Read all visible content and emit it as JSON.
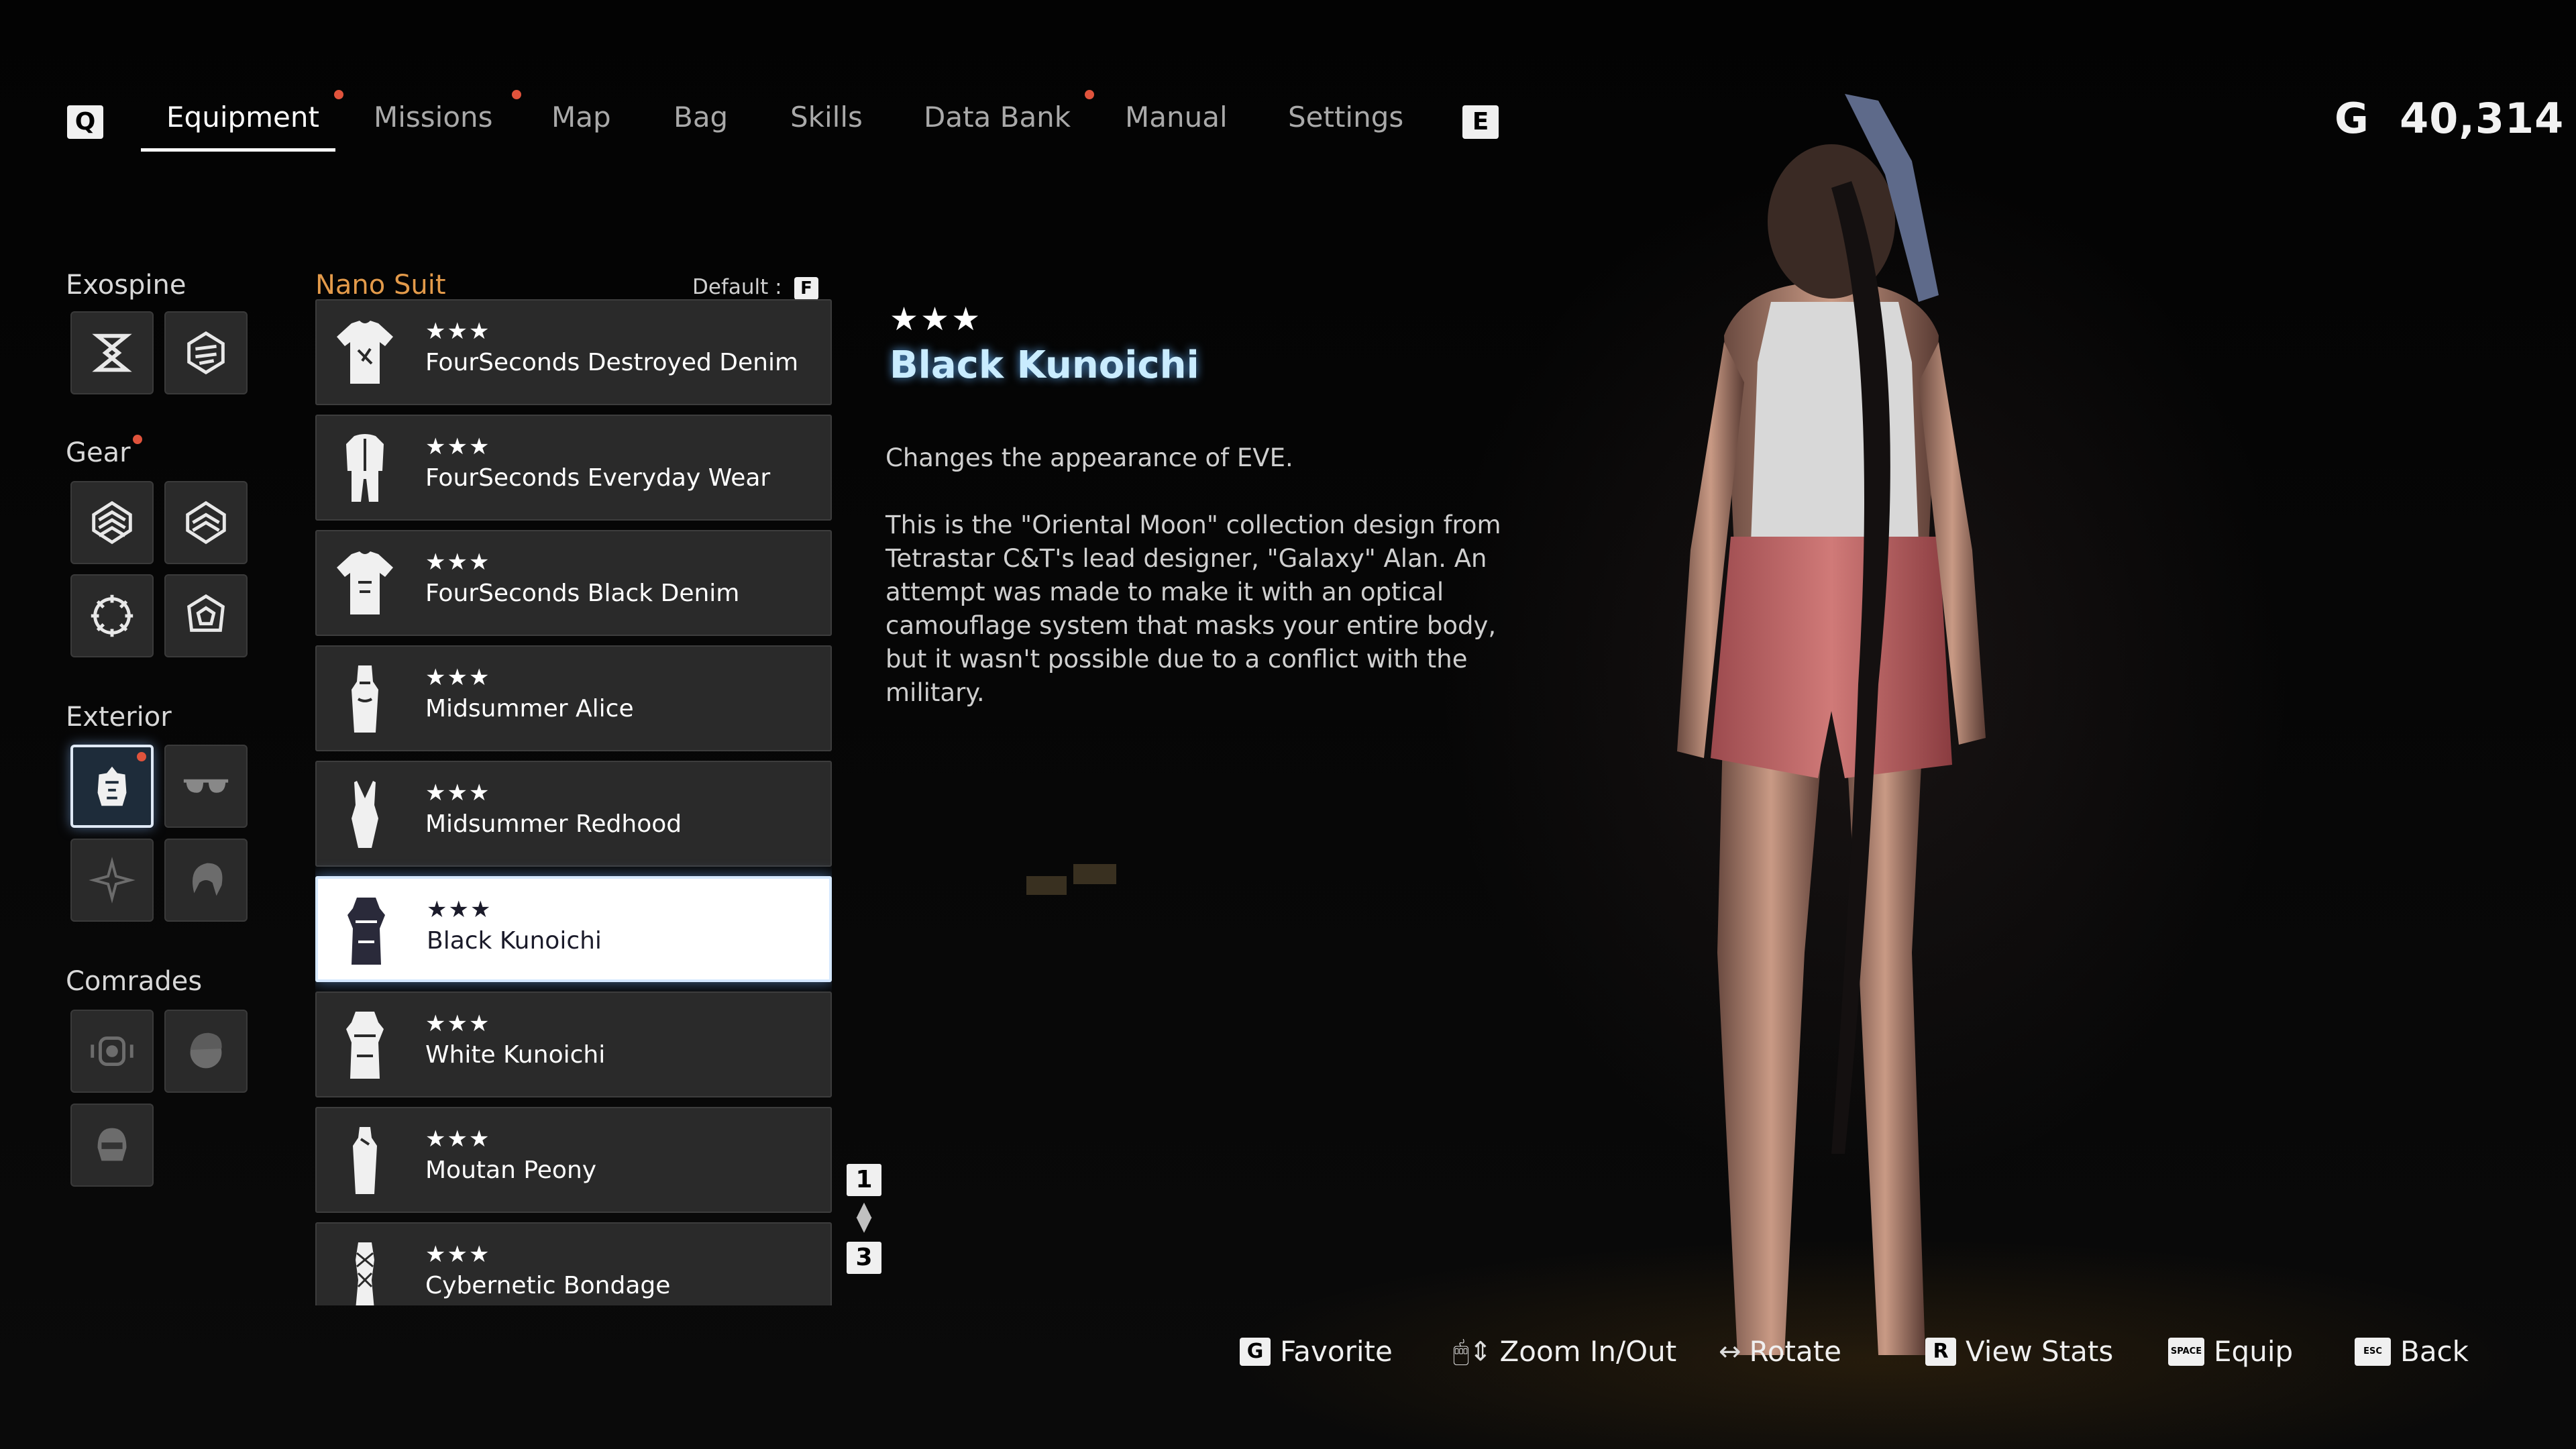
{
  "nav": {
    "left_key": "Q",
    "right_key": "E",
    "tabs": [
      {
        "label": "Equipment",
        "active": true,
        "notify": true
      },
      {
        "label": "Missions",
        "active": false,
        "notify": true
      },
      {
        "label": "Map",
        "active": false,
        "notify": false
      },
      {
        "label": "Bag",
        "active": false,
        "notify": false
      },
      {
        "label": "Skills",
        "active": false,
        "notify": false
      },
      {
        "label": "Data Bank",
        "active": false,
        "notify": true
      },
      {
        "label": "Manual",
        "active": false,
        "notify": false
      },
      {
        "label": "Settings",
        "active": false,
        "notify": false
      }
    ]
  },
  "currency": {
    "symbol": "G",
    "amount": "40,314"
  },
  "categories": {
    "exospine": "Exospine",
    "gear": "Gear",
    "exterior": "Exterior",
    "comrades": "Comrades"
  },
  "list": {
    "title": "Nano Suit",
    "default_label": "Default :",
    "default_key": "F",
    "items": [
      {
        "stars": "★★★",
        "name": "FourSeconds Destroyed Denim",
        "icon": "tshirt-icon"
      },
      {
        "stars": "★★★",
        "name": "FourSeconds Everyday Wear",
        "icon": "hoodie-outfit-icon"
      },
      {
        "stars": "★★★",
        "name": "FourSeconds Black Denim",
        "icon": "tshirt-icon"
      },
      {
        "stars": "★★★",
        "name": "Midsummer Alice",
        "icon": "dress-icon"
      },
      {
        "stars": "★★★",
        "name": "Midsummer Redhood",
        "icon": "swimsuit-icon"
      },
      {
        "stars": "★★★",
        "name": "Black Kunoichi",
        "icon": "kunoichi-outfit-icon",
        "selected": true
      },
      {
        "stars": "★★★",
        "name": "White Kunoichi",
        "icon": "kunoichi-outfit-icon"
      },
      {
        "stars": "★★★",
        "name": "Moutan Peony",
        "icon": "qipao-icon"
      },
      {
        "stars": "★★★",
        "name": "Cybernetic Bondage",
        "icon": "bodysuit-icon"
      }
    ],
    "page_current": "1",
    "page_total": "3"
  },
  "detail": {
    "stars": "★★★",
    "title": "Black Kunoichi",
    "description_1": "Changes the appearance of EVE.",
    "description_2": "This is the \"Oriental Moon\" collection design from Tetrastar C&T's lead designer, \"Galaxy\" Alan. An attempt was made to make it with an optical camouflage system that masks your entire body, but it wasn't possible due to a conflict with the military."
  },
  "prompts": [
    {
      "key": "G",
      "label": "Favorite"
    },
    {
      "key": "",
      "label": "Zoom In/Out"
    },
    {
      "key": "",
      "label": "Rotate"
    },
    {
      "key": "R",
      "label": "View Stats"
    },
    {
      "key": "SPACE",
      "label": "Equip"
    },
    {
      "key": "ESC",
      "label": "Back"
    }
  ],
  "colors": {
    "accent_orange": "#e39a4a",
    "notify_dot": "#e0533c",
    "title_glow": "#c9ecff"
  }
}
